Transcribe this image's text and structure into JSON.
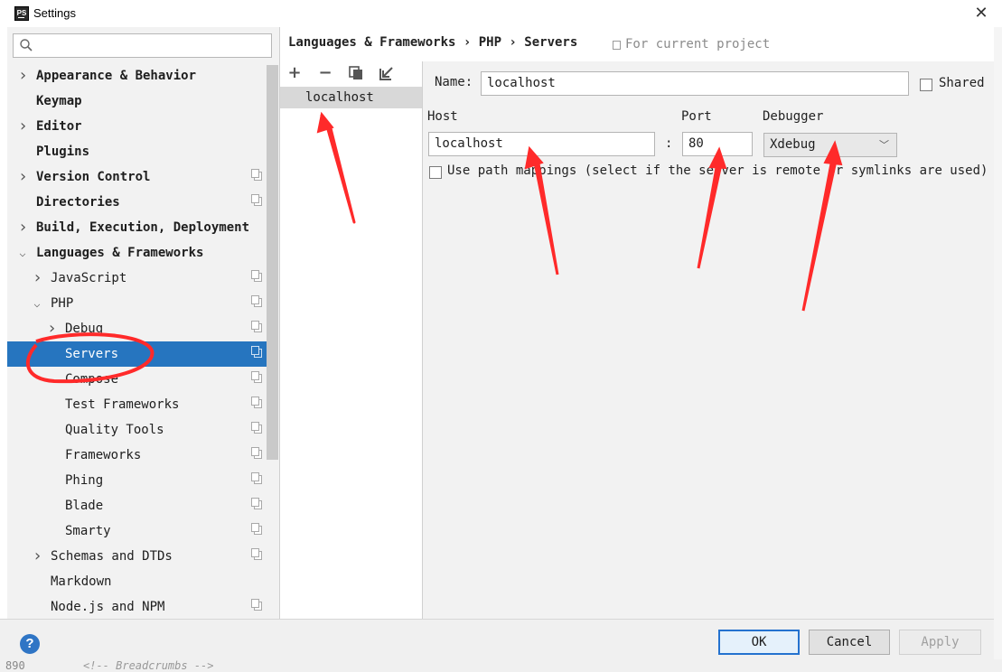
{
  "window": {
    "title": "Settings",
    "app_icon_text": "PS"
  },
  "breadcrumb": "Languages & Frameworks › PHP › Servers",
  "scope_label": "For current project",
  "tree": [
    {
      "label": "Appearance & Behavior",
      "level": 0,
      "arrow": "collapsed",
      "bold": true,
      "project": false
    },
    {
      "label": "Keymap",
      "level": 0,
      "arrow": "none",
      "bold": true,
      "project": false
    },
    {
      "label": "Editor",
      "level": 0,
      "arrow": "collapsed",
      "bold": true,
      "project": false
    },
    {
      "label": "Plugins",
      "level": 0,
      "arrow": "none",
      "bold": true,
      "project": false
    },
    {
      "label": "Version Control",
      "level": 0,
      "arrow": "collapsed",
      "bold": true,
      "project": true
    },
    {
      "label": "Directories",
      "level": 0,
      "arrow": "none",
      "bold": true,
      "project": true
    },
    {
      "label": "Build, Execution, Deployment",
      "level": 0,
      "arrow": "collapsed",
      "bold": true,
      "project": false
    },
    {
      "label": "Languages & Frameworks",
      "level": 0,
      "arrow": "expanded",
      "bold": true,
      "project": false
    },
    {
      "label": "JavaScript",
      "level": 1,
      "arrow": "collapsed",
      "bold": false,
      "project": true
    },
    {
      "label": "PHP",
      "level": 1,
      "arrow": "expanded",
      "bold": false,
      "project": true
    },
    {
      "label": "Debug",
      "level": 2,
      "arrow": "collapsed",
      "bold": false,
      "project": true
    },
    {
      "label": "Servers",
      "level": 2,
      "arrow": "none",
      "bold": false,
      "project": true,
      "selected": true
    },
    {
      "label": "Compose",
      "level": 2,
      "arrow": "none",
      "bold": false,
      "project": true
    },
    {
      "label": "Test Frameworks",
      "level": 2,
      "arrow": "none",
      "bold": false,
      "project": true
    },
    {
      "label": "Quality Tools",
      "level": 2,
      "arrow": "none",
      "bold": false,
      "project": true
    },
    {
      "label": "Frameworks",
      "level": 2,
      "arrow": "none",
      "bold": false,
      "project": true
    },
    {
      "label": "Phing",
      "level": 2,
      "arrow": "none",
      "bold": false,
      "project": true
    },
    {
      "label": "Blade",
      "level": 2,
      "arrow": "none",
      "bold": false,
      "project": true
    },
    {
      "label": "Smarty",
      "level": 2,
      "arrow": "none",
      "bold": false,
      "project": true
    },
    {
      "label": "Schemas and DTDs",
      "level": 1,
      "arrow": "collapsed",
      "bold": false,
      "project": true
    },
    {
      "label": "Markdown",
      "level": 1,
      "arrow": "none",
      "bold": false,
      "project": false
    },
    {
      "label": "Node.js and NPM",
      "level": 1,
      "arrow": "none",
      "bold": false,
      "project": true
    }
  ],
  "server_list": {
    "toolbar": {
      "add": "+",
      "remove": "−",
      "copy": "copy-icon",
      "import": "import-icon"
    },
    "items": [
      "localhost"
    ]
  },
  "form": {
    "name_label": "Name:",
    "name_value": "localhost",
    "shared_label": "Shared",
    "shared_checked": false,
    "host_label": "Host",
    "host_value": "localhost",
    "separator": ":",
    "port_label": "Port",
    "port_value": "80",
    "debugger_label": "Debugger",
    "debugger_value": "Xdebug",
    "path_mappings_label": "Use path mappings (select if the server is remote or symlinks are used)",
    "path_mappings_checked": false
  },
  "buttons": {
    "help": "?",
    "ok": "OK",
    "cancel": "Cancel",
    "apply": "Apply"
  },
  "background_editor": {
    "line_number": "890",
    "breadcrumbs_text": "<!-- Breadcrumbs -->"
  },
  "colors": {
    "selection": "#2675bf",
    "annotation": "#ff2a2a",
    "ok_border": "#2472cf"
  }
}
